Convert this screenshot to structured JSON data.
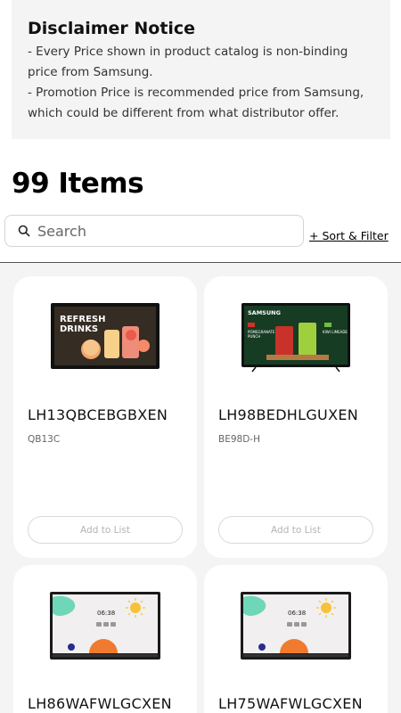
{
  "disclaimer": {
    "title": "Disclaimer Notice",
    "lines": [
      "- Every Price shown in product catalog is non-binding",
      "price from Samsung.",
      "- Promotion Price is recommended price from Samsung,",
      "which could be different from what distributor offer."
    ]
  },
  "catalog": {
    "items_count": "99 Items",
    "search_placeholder": "Search",
    "sort_filter_label": "+ Sort & Filter"
  },
  "products": [
    {
      "model": "LH13QBCEBGBXEN",
      "sub": "QB13C",
      "add_label": "Add to List",
      "screen_text": [
        "REFRESH",
        "DRINKS"
      ]
    },
    {
      "model": "LH98BEDHLGUXEN",
      "sub": "BE98D-H",
      "add_label": "Add to List",
      "screen_text": [
        "SAMSUNG",
        "POMEGRANATE",
        "PUNCH",
        "KIWI LIMEADE"
      ]
    },
    {
      "model": "LH86WAFWLGCXEN",
      "sub": "",
      "add_label": "",
      "screen_text": [
        "06:38"
      ]
    },
    {
      "model": "LH75WAFWLGCXEN",
      "sub": "",
      "add_label": "",
      "screen_text": [
        "06:38"
      ]
    }
  ],
  "colors": {
    "page_bg": "#f4f4f4",
    "card_bg": "#ffffff",
    "text_primary": "#111111",
    "text_muted": "#666666",
    "button_text": "#b3b3b3"
  }
}
